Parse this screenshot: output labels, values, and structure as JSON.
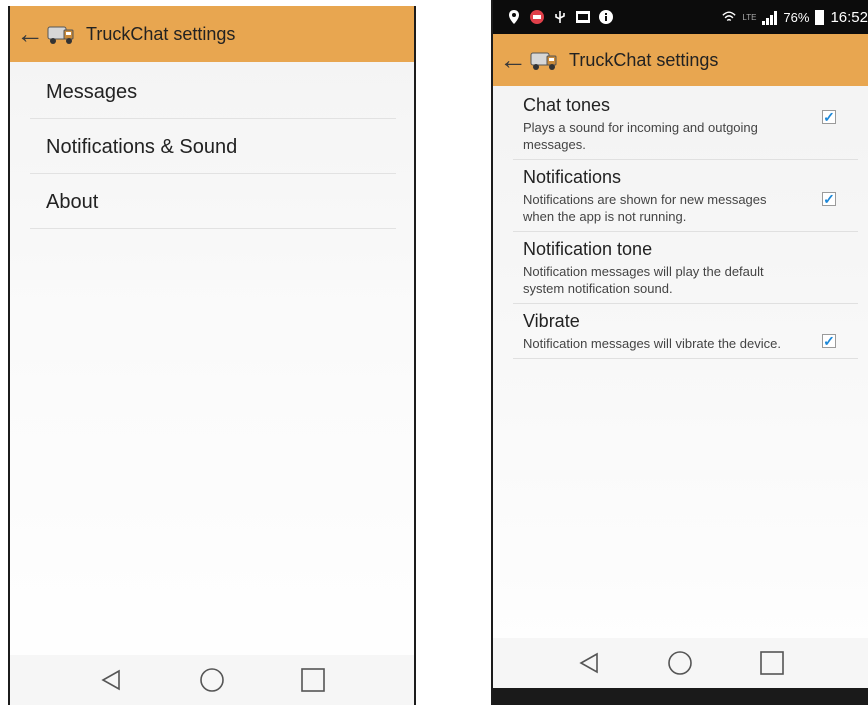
{
  "left_screen": {
    "appbar": {
      "title": "TruckChat settings"
    },
    "menu_items": [
      {
        "label": "Messages"
      },
      {
        "label": "Notifications & Sound"
      },
      {
        "label": "About"
      }
    ]
  },
  "right_screen": {
    "statusbar": {
      "icons": [
        "location-icon",
        "record-icon",
        "usb-icon",
        "gallery-icon",
        "info-icon"
      ],
      "battery_percent": "76%",
      "time": "16:52",
      "network_label": "LTE"
    },
    "appbar": {
      "title": "TruckChat settings"
    },
    "settings": [
      {
        "title": "Chat tones",
        "description": "Plays a sound for incoming and outgoing messages.",
        "checked": true
      },
      {
        "title": "Notifications",
        "description": "Notifications are shown for new messages when the app is not running.",
        "checked": true
      },
      {
        "title": "Notification tone",
        "description": "Notification messages will play the default system notification sound.",
        "checked": null
      },
      {
        "title": "Vibrate",
        "description": "Notification messages will vibrate the device.",
        "checked": true
      }
    ]
  },
  "navbar": {
    "icons": [
      "back-icon",
      "home-icon",
      "recents-icon"
    ]
  },
  "colors": {
    "appbar": "#e8a650",
    "checkbox_tick": "#1e88d8",
    "statusbar": "#0c0c0c"
  }
}
